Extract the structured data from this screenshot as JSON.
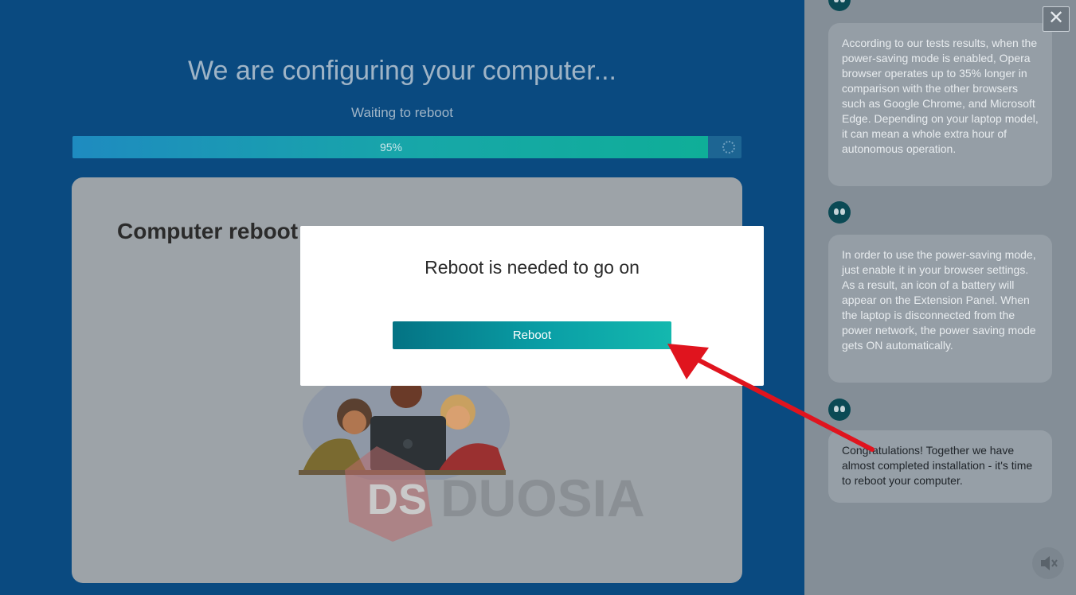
{
  "main": {
    "title": "We are configuring your computer...",
    "status": "Waiting to reboot",
    "progress": {
      "label": "95%",
      "value": 0.95
    },
    "card": {
      "heading": "Computer reboot"
    }
  },
  "watermark": {
    "mark": "DS",
    "text": "DUOSIA"
  },
  "modal": {
    "title": "Reboot is needed to go on",
    "button_label": "Reboot"
  },
  "sidebar": {
    "messages": [
      {
        "text": "According to our tests results, when the power-saving mode is enabled, Opera browser operates up to 35% longer in comparison with the other browsers such as Google Chrome, and Microsoft Edge. Depending on your laptop model, it can mean a whole extra hour of autonomous operation."
      },
      {
        "text": "In order to use the power-saving mode, just enable it in your browser settings. As a result, an icon of a battery will appear on the Extension Panel. When the laptop is disconnected from the power network, the power saving mode gets ON automatically."
      },
      {
        "text": "Congratulations! Together we have almost completed installation - it's time to reboot your computer."
      }
    ],
    "close_icon": "close-icon",
    "mute_icon": "mute-icon"
  },
  "colors": {
    "accent": "#0fa9a6",
    "annotation": "#e0141e"
  }
}
